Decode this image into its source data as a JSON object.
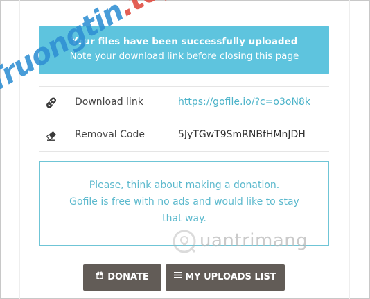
{
  "banner": {
    "title": "Your files have been successfully uploaded",
    "subtitle": "Note your download link before closing this page"
  },
  "rows": [
    {
      "icon": "link-icon",
      "label": "Download link",
      "value": "https://gofile.io/?c=o3oN8k"
    },
    {
      "icon": "eraser-icon",
      "label": "Removal Code",
      "value": "5JyTGwT9SmRNBfHMnJDH"
    }
  ],
  "donation": {
    "lines": [
      "Please, think about making a donation.",
      "Gofile is free with no ads and would like to stay",
      "that way."
    ]
  },
  "buttons": {
    "donate": {
      "icon": "gift-icon",
      "label": "DONATE"
    },
    "uploads": {
      "icon": "list-icon",
      "label": "MY UPLOADS LIST"
    }
  },
  "watermarks": {
    "primary_blue": "Truongtin",
    "primary_red": ".top",
    "secondary": "uantrimang"
  },
  "colors": {
    "banner_bg": "#5ec4de",
    "accent": "#4cb3c9",
    "button_bg": "#625c57",
    "watermark_blue": "#2f8fd3",
    "watermark_red": "#e04a3e"
  }
}
